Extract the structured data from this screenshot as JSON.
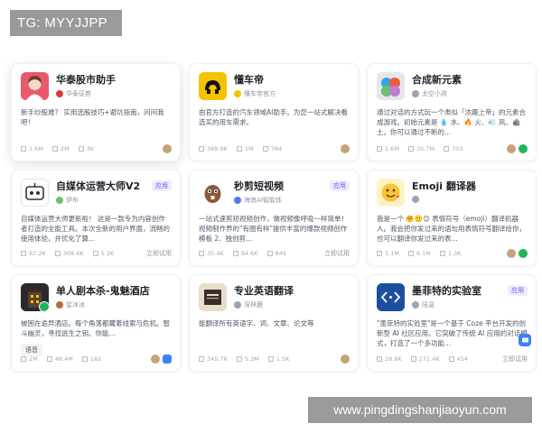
{
  "watermark_top": "TG: MYYJJPP",
  "watermark_bottom": "www.pingdingshanjiaoyun.com",
  "cards": [
    {
      "title": "华泰股市助手",
      "tag": "",
      "author": "华泰证券",
      "description": "新手炒股难？ 实用选股技巧+避坑指南，问问我吧！",
      "stats": [
        "1.6M",
        "2M",
        "3K"
      ],
      "action": "",
      "avatar_icon": "woman-portrait-icon",
      "avatar_color": "#e85a6b"
    },
    {
      "title": "懂车帝",
      "tag": "",
      "author": "懂车帝官方",
      "description": "由官方打造的汽车领域AI助手。为您一站式解决看选买的用车需求。",
      "stats": [
        "369.9K",
        "1M",
        "784"
      ],
      "action": "",
      "avatar_icon": "car-logo-icon",
      "avatar_color": "#f5c300"
    },
    {
      "title": "合成新元素",
      "tag": "",
      "author": "太空小孩",
      "description": "通过对话的方式玩一个类似「浓趣上帝」的元素合成游戏。初始元素是 💧 水、🔥 火、💨 风、🪨 土。你可以通过不断的...",
      "stats": [
        "1.6M",
        "35.7M",
        "703"
      ],
      "action": "",
      "avatar_icon": "elements-icon",
      "avatar_color": "#d9dde3"
    },
    {
      "title": "自媒体运营大师V2",
      "tag": "应用",
      "author": "伊布",
      "description": "自媒体运营大师更新啦！ 这是一款专为内容创作者打造的全能工具。本次全新的用户界面，流畅的使用体验，并优化了算...",
      "stats": [
        "82.2K",
        "308.6K",
        "5.2K"
      ],
      "action": "立即试用",
      "avatar_icon": "media-robot-icon",
      "avatar_color": "#ffffff"
    },
    {
      "title": "秒剪短视频",
      "tag": "应用",
      "author": "海浪AI智能体",
      "description": "一站式速剪短视频创作，做视频像呼吸一样简单！视频制作界的\"有图有样\"提供丰富的爆款视频创作模板 2、独创剪...",
      "stats": [
        "35.4K",
        "94.6K",
        "849"
      ],
      "action": "立即试用",
      "avatar_icon": "beaver-icon",
      "avatar_color": "#ffffff"
    },
    {
      "title": "Emoji 翻译器",
      "tag": "",
      "author": "",
      "description": "我是一个 🤗🙂😊 表情符号（emoji）翻译机器人。我会把你发过来的语句用表情符号翻译给你，也可以翻译你发过来的表...",
      "stats": [
        "1.1M",
        "6.1M",
        "1.3K"
      ],
      "action": "",
      "avatar_icon": "emoji-face-icon",
      "avatar_color": "#fff3c4"
    },
    {
      "title": "单人剧本杀-鬼魅酒店",
      "tag": "",
      "author": "星沐冰",
      "description": "被困在诡异酒店。每个角落都藏着线索与危机。智斗幽灵，寻找逃生之钥。你能...",
      "pill": "语音",
      "stats": [
        "2M",
        "48.4M",
        "182"
      ],
      "action": "",
      "avatar_icon": "ghost-hotel-icon",
      "avatar_color": "#2a2a2a"
    },
    {
      "title": "专业英语翻译",
      "tag": "",
      "author": "深林鹿",
      "description": "能翻译所有英语字、词、文章、论文等",
      "stats": [
        "345.7K",
        "5.3M",
        "1.5K"
      ],
      "action": "",
      "avatar_icon": "book-cover-icon",
      "avatar_color": "#e8dccb"
    },
    {
      "title": "墨菲特的实验室",
      "tag": "应用",
      "author": "陆温",
      "description": "\"墨菲特的实验室\"是一个基于 Coze 平台开发的创新型 AI 社区应用。它突破了传统 AI 应用的对话模式，打造了一个多功能...",
      "stats": [
        "28.8K",
        "271.4K",
        "454"
      ],
      "action": "立即试用",
      "avatar_icon": "code-brackets-icon",
      "avatar_color": "#1d4fa0"
    }
  ]
}
